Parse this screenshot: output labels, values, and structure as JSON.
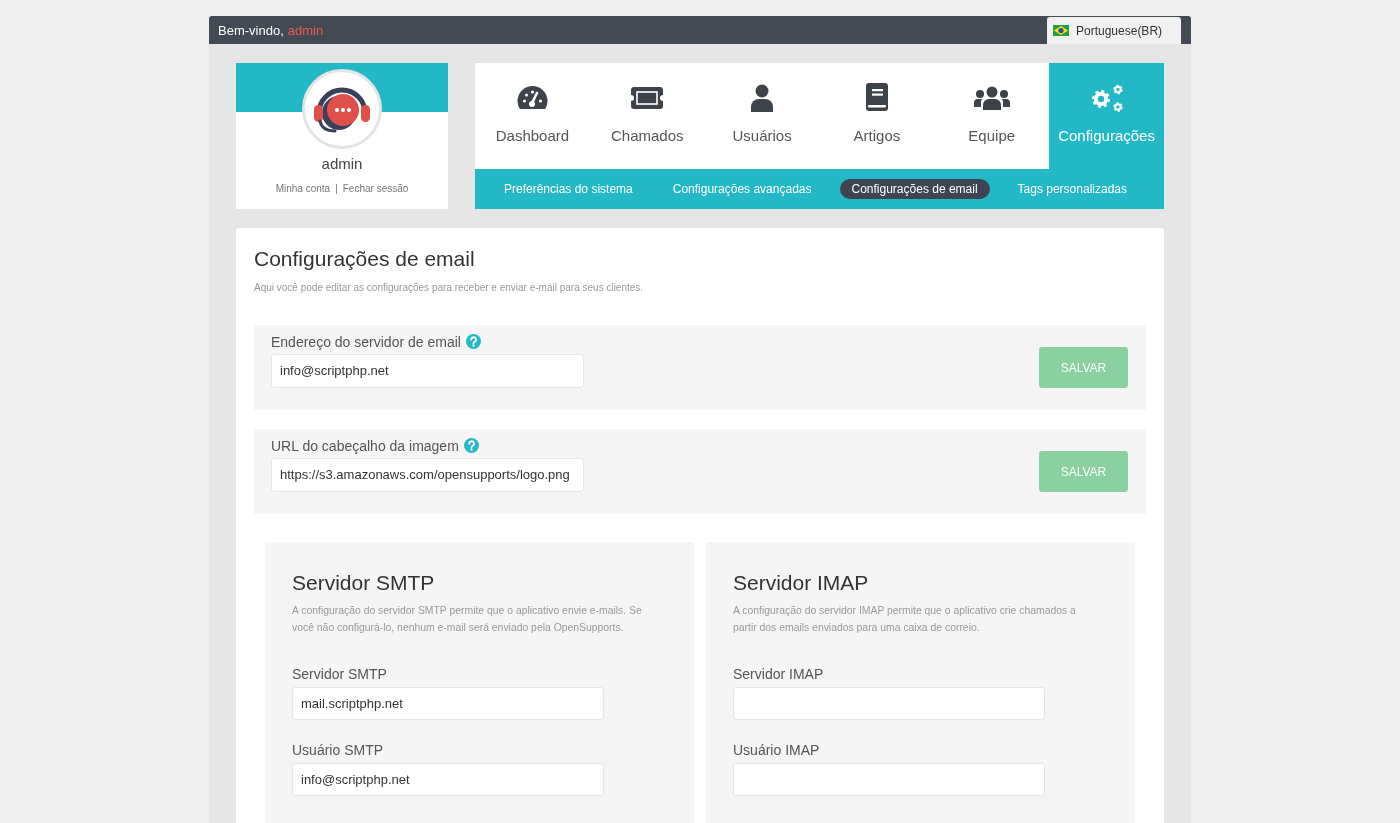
{
  "top_bar": {
    "greeting": "Bem-vindo,",
    "username": "admin",
    "language": "Portuguese(BR)"
  },
  "profile": {
    "name": "admin",
    "links": [
      "Minha conta",
      "Fechar sessão"
    ],
    "separator": "|"
  },
  "nav": {
    "items": [
      {
        "label": "Dashboard",
        "selected": false
      },
      {
        "label": "Chamados",
        "selected": false
      },
      {
        "label": "Usuários",
        "selected": false
      },
      {
        "label": "Artigos",
        "selected": false
      },
      {
        "label": "Equipe",
        "selected": false
      },
      {
        "label": "Configurações",
        "selected": true
      }
    ]
  },
  "subnav": {
    "items": [
      {
        "label": "Preferências do sistema",
        "selected": false
      },
      {
        "label": "Configurações avançadas",
        "selected": false
      },
      {
        "label": "Configurações de email",
        "selected": true
      },
      {
        "label": "Tags personalizadas",
        "selected": false
      }
    ]
  },
  "page": {
    "title": "Configurações de email",
    "description": "Aqui você pode editar as configurações para receber e enviar e-mail para seus clientes."
  },
  "settings": [
    {
      "label": "Endereço do servidor de email",
      "value": "info@scriptphp.net",
      "button": "SALVAR"
    },
    {
      "label": "URL do cabeçalho da imagem",
      "value": "https://s3.amazonaws.com/opensupports/logo.png",
      "button": "SALVAR"
    }
  ],
  "servers": [
    {
      "title": "Servidor SMTP",
      "description": "A configuração do servidor SMTP permite que o aplicativo envie e-mails. Se você não configurá-lo, nenhum e-mail será enviado pela OpenSupports.",
      "fields": [
        {
          "label": "Servidor SMTP",
          "value": "mail.scriptphp.net"
        },
        {
          "label": "Usuário SMTP",
          "value": "info@scriptphp.net"
        }
      ]
    },
    {
      "title": "Servidor IMAP",
      "description": "A configuração do servidor IMAP permite que o aplicativo crie chamados a partir dos emails enviados para uma caixa de correio.",
      "fields": [
        {
          "label": "Servidor IMAP"
        },
        {
          "label": "Usuário IMAP"
        }
      ]
    }
  ]
}
